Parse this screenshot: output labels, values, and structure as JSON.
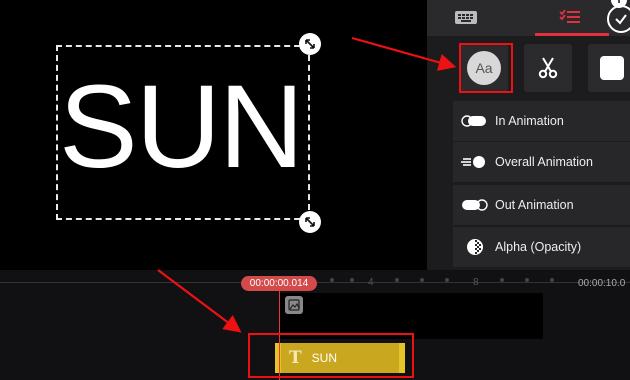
{
  "preview": {
    "text_layer": "SUN"
  },
  "panel": {
    "tabs": [
      {
        "name": "keyboard-tab",
        "active": false
      },
      {
        "name": "settings-list-tab",
        "active": true
      }
    ],
    "accent_color": "#e3303e",
    "top_buttons": [
      {
        "icon": "font-style-icon",
        "label": "Aa"
      },
      {
        "icon": "scissors-icon"
      },
      {
        "icon": "square-icon"
      }
    ],
    "menu": [
      {
        "label": "In Animation",
        "icon": "in-animation-icon"
      },
      {
        "label": "Overall Animation",
        "icon": "overall-animation-icon"
      },
      {
        "label": "Out Animation",
        "icon": "out-animation-icon"
      },
      {
        "label": "Alpha (Opacity)",
        "icon": "opacity-icon"
      }
    ]
  },
  "timeline": {
    "current_time": "00:00:00.014",
    "end_time": "00:00:10.0",
    "ruler_marks": [
      "4",
      "8"
    ],
    "text_clip": {
      "label": "SUN",
      "icon": "text-icon",
      "color": "#c9a820"
    }
  },
  "annotations": {
    "highlight_color": "#e11111"
  }
}
